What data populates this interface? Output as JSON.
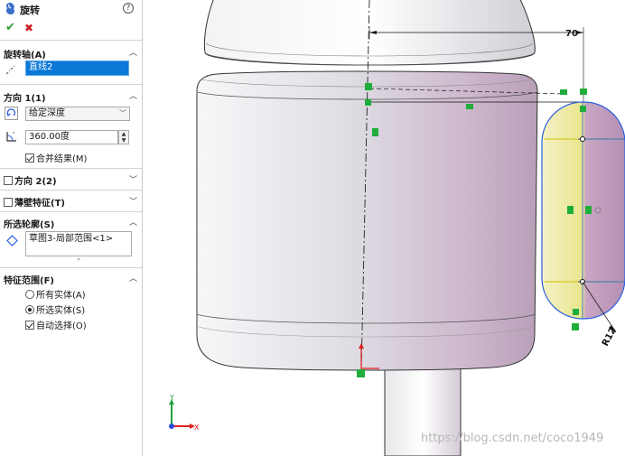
{
  "panel": {
    "title": "旋转",
    "help_icon": "?",
    "ok_icon": "✔",
    "cancel_icon": "✖",
    "axis": {
      "title": "旋转轴(A)",
      "value": "直线2"
    },
    "dir1": {
      "title": "方向 1(1)",
      "end_condition": "给定深度",
      "angle": "360.00度",
      "merge_label": "合并结果(M)",
      "merge_checked": true
    },
    "dir2": {
      "title": "方向 2(2)"
    },
    "thin": {
      "title": "薄壁特征(T)"
    },
    "contours": {
      "title": "所选轮廓(S)",
      "value": "草图3-局部范围<1>"
    },
    "scope": {
      "title": "特征范围(F)",
      "option_all": "所有实体(A)",
      "option_selected": "所选实体(S)",
      "auto_select": "自动选择(O)"
    }
  },
  "viewport": {
    "dimension_width": "70",
    "dimension_radius": "R12",
    "triad_y": "Y",
    "triad_x": "X",
    "watermark": "https://blog.csdn.net/coco1949"
  },
  "colors": {
    "selection_blue": "#0a78d7",
    "sketch_blue": "#2a5fe0",
    "relation_green": "#1fae3b",
    "preview_yellow": "#f1ee9a",
    "preview_purple": "#c8a3c2",
    "body_shade": "#bfbfc6"
  }
}
